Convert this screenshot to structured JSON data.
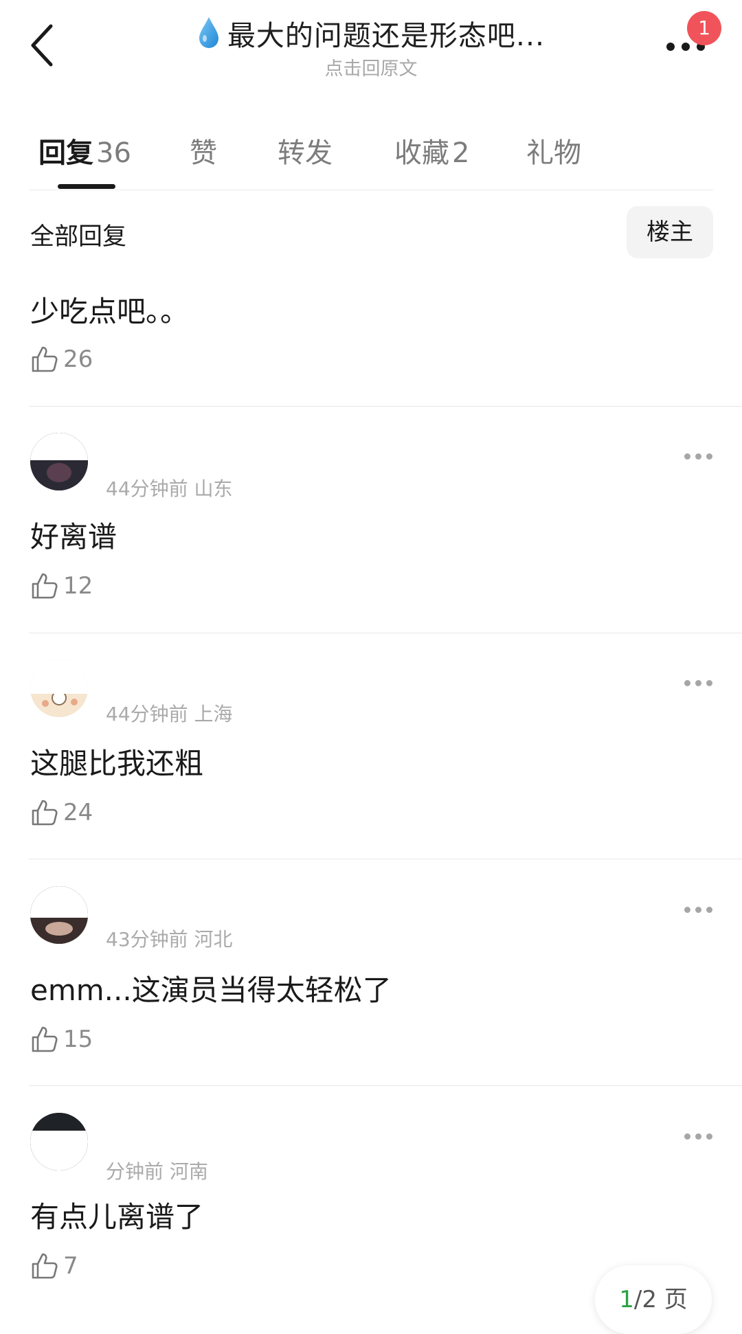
{
  "header": {
    "title": "最大的问题还是形态吧...",
    "subtitle": "点击回原文",
    "badge_count": "1"
  },
  "tabs": [
    {
      "label": "回复",
      "count": "36",
      "active": true
    },
    {
      "label": "赞",
      "count": ""
    },
    {
      "label": "转发",
      "count": ""
    },
    {
      "label": "收藏",
      "count": "2"
    },
    {
      "label": "礼物",
      "count": ""
    }
  ],
  "filter": {
    "label": "全部回复",
    "op_button": "楼主"
  },
  "replies": [
    {
      "meta": "",
      "content": "少吃点吧。。",
      "likes": "26"
    },
    {
      "meta": "44分钟前 山东",
      "content": "好离谱",
      "likes": "12"
    },
    {
      "meta": "44分钟前 上海",
      "content": "这腿比我还粗",
      "likes": "24"
    },
    {
      "meta": "43分钟前 河北",
      "content": "emm...这演员当得太轻松了",
      "likes": "15"
    },
    {
      "meta": "分钟前 河南",
      "content": "有点儿离谱了",
      "likes": "7"
    }
  ],
  "pager": {
    "current": "1",
    "rest": "/2 页"
  },
  "colors": {
    "badge": "#f0545a",
    "pager_current": "#2aa243",
    "drop_icon": "#2f9be6"
  }
}
